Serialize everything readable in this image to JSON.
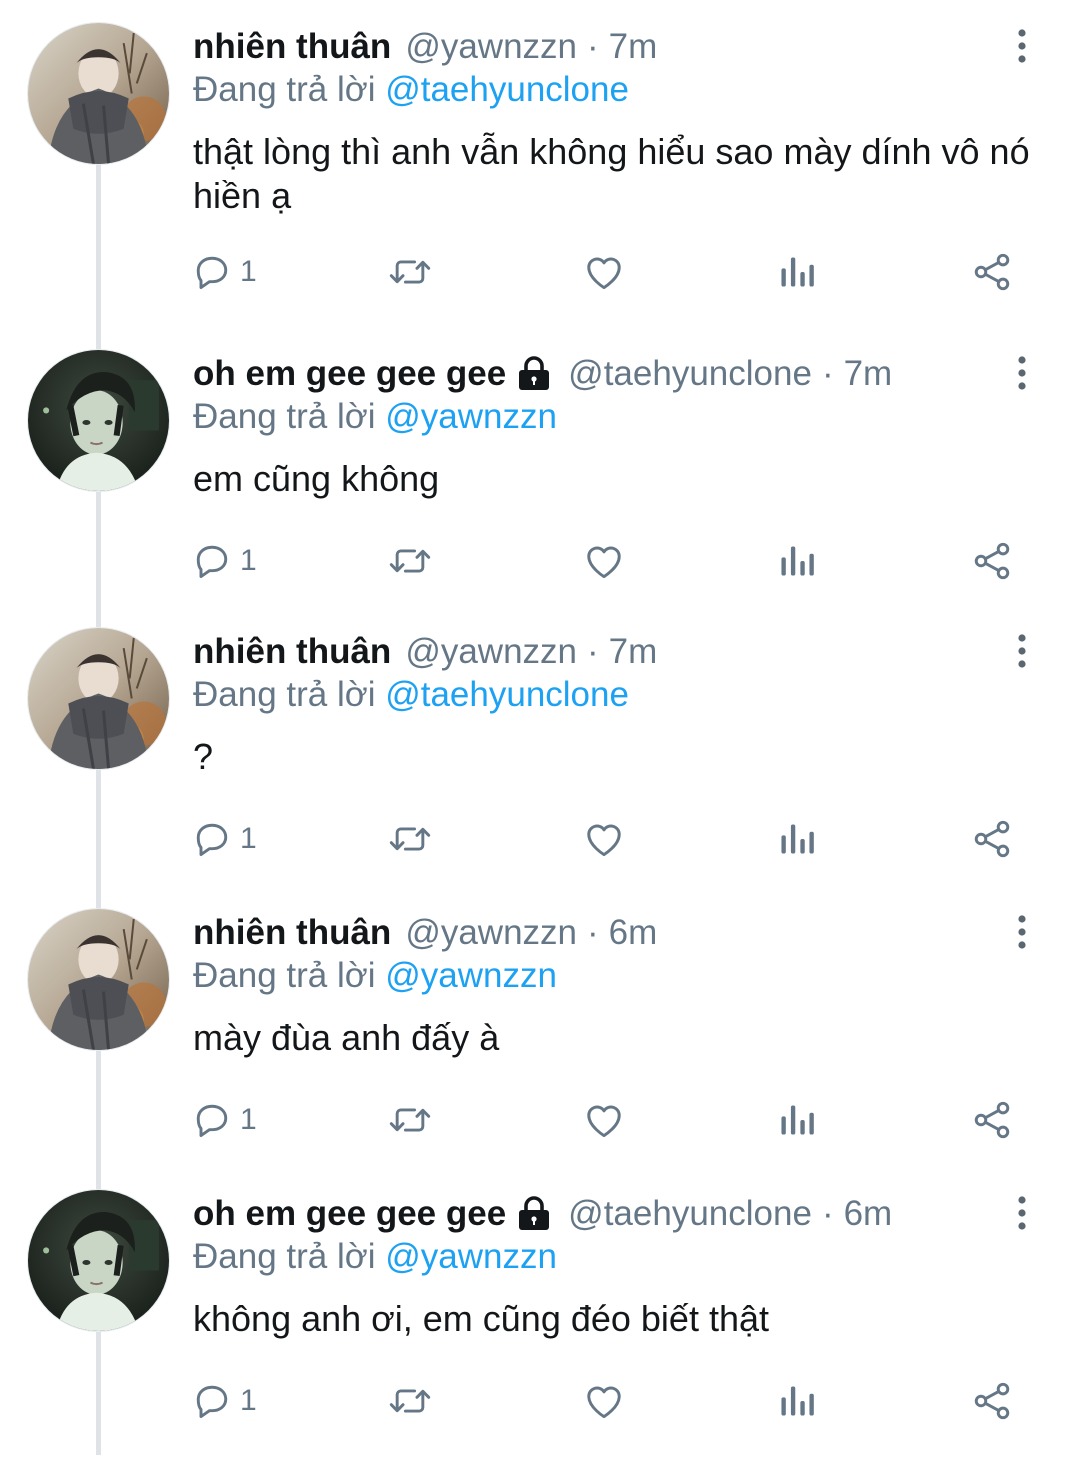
{
  "tweets": [
    {
      "name": "nhiên thuân",
      "handle": "@yawnzzn",
      "time": "7m",
      "locked": false,
      "replying_label": "Đang trả lời",
      "replying_to": "@taehyunclone",
      "text": "thật lòng thì anh vẫn không hiểu sao mày dính vô nó hiền ạ",
      "reply_count": "1",
      "avatar": "avatar-scarf"
    },
    {
      "name": "oh em gee gee gee",
      "handle": "@taehyunclone",
      "time": "7m",
      "locked": true,
      "replying_label": "Đang trả lời",
      "replying_to": "@yawnzzn",
      "text": "em cũng không",
      "reply_count": "1",
      "avatar": "avatar-dark"
    },
    {
      "name": "nhiên thuân",
      "handle": "@yawnzzn",
      "time": "7m",
      "locked": false,
      "replying_label": "Đang trả lời",
      "replying_to": "@taehyunclone",
      "text": "?",
      "reply_count": "1",
      "avatar": "avatar-scarf"
    },
    {
      "name": "nhiên thuân",
      "handle": "@yawnzzn",
      "time": "6m",
      "locked": false,
      "replying_label": "Đang trả lời",
      "replying_to": "@yawnzzn",
      "text": "mày đùa anh đấy à",
      "reply_count": "1",
      "avatar": "avatar-scarf"
    },
    {
      "name": "oh em gee gee gee",
      "handle": "@taehyunclone",
      "time": "6m",
      "locked": true,
      "replying_label": "Đang trả lời",
      "replying_to": "@yawnzzn",
      "text": "không anh ơi, em cũng đéo biết thật",
      "reply_count": "1",
      "avatar": "avatar-dark"
    }
  ],
  "icons": {
    "reply": "reply-icon",
    "retweet": "retweet-icon",
    "like": "heart-icon",
    "analytics": "analytics-icon",
    "share": "share-icon",
    "more": "more-vertical-icon",
    "lock": "lock-icon"
  },
  "colors": {
    "text": "#14171a",
    "secondary": "#657786",
    "mention": "#1da1f2",
    "thread_line": "#dfe3e8"
  }
}
